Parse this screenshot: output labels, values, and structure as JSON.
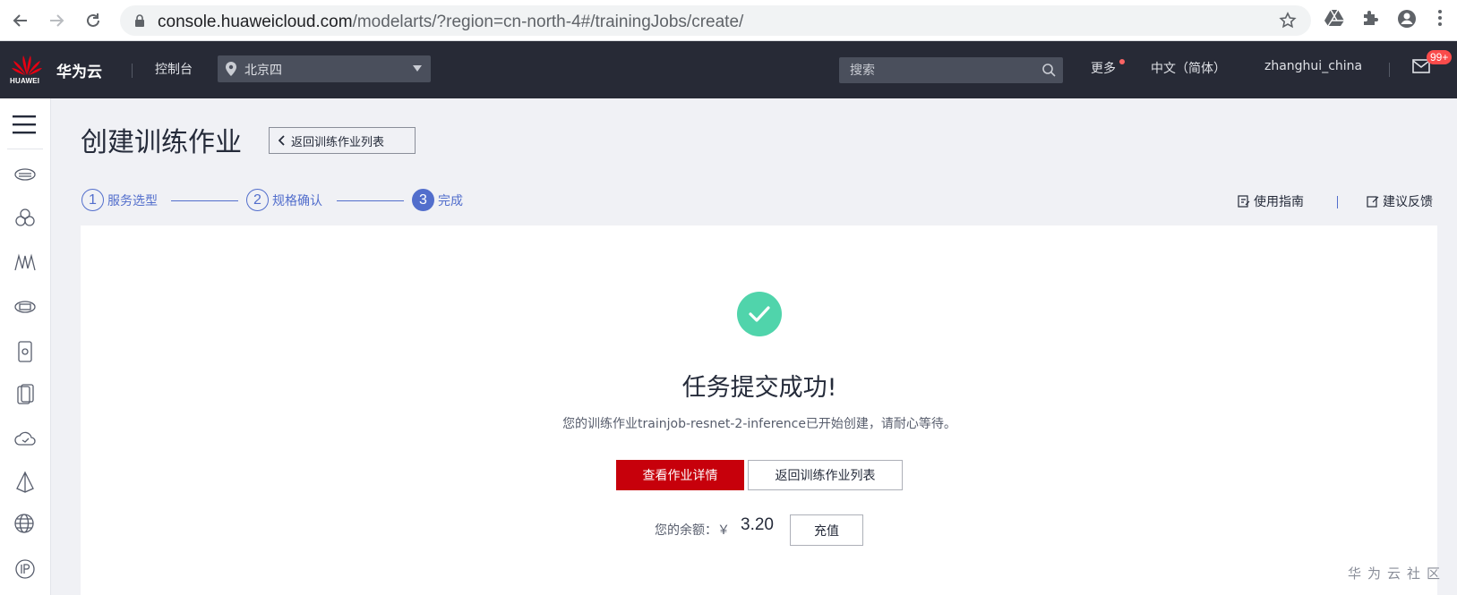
{
  "browser": {
    "url_domain": "console.huaweicloud.com",
    "url_path": "/modelarts/?region=cn-north-4#/trainingJobs/create/"
  },
  "header": {
    "logo_text": "HUAWEI",
    "brand": "华为云",
    "console": "控制台",
    "region": "北京四",
    "search_placeholder": "搜索",
    "more": "更多",
    "language": "中文（简体）",
    "username": "zhanghui_china",
    "mail_badge": "99+"
  },
  "page": {
    "title": "创建训练作业",
    "back_button": "返回训练作业列表",
    "steps": [
      {
        "number": "1",
        "label": "服务选型",
        "active": false
      },
      {
        "number": "2",
        "label": "规格确认",
        "active": false
      },
      {
        "number": "3",
        "label": "完成",
        "active": true
      }
    ],
    "guide_link": "使用指南",
    "feedback_link": "建议反馈"
  },
  "result": {
    "title": "任务提交成功!",
    "message": "您的训练作业trainjob-resnet-2-inference已开始创建，请耐心等待。",
    "primary_button": "查看作业详情",
    "secondary_button": "返回训练作业列表",
    "balance_label": "您的余额：￥",
    "balance_value": "3.20",
    "recharge_button": "充值"
  },
  "watermark": "华为云社区",
  "colors": {
    "header_bg": "#272a36",
    "accent_blue": "#526ecc",
    "primary_red": "#c7000b",
    "success_green": "#50d4ab"
  }
}
